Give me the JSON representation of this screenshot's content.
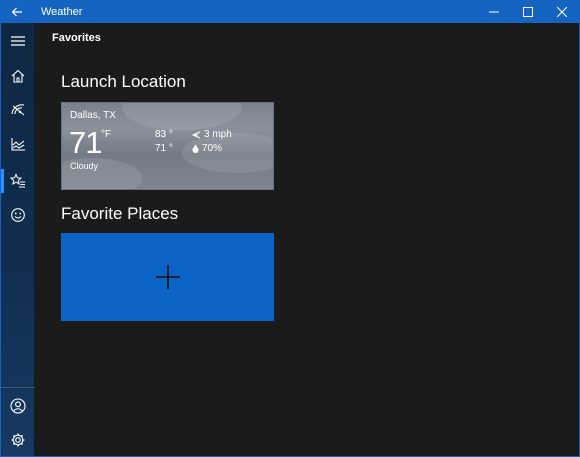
{
  "app": {
    "title": "Weather"
  },
  "page": {
    "title": "Favorites"
  },
  "launch": {
    "heading": "Launch Location",
    "city": "Dallas, TX",
    "temp": "71",
    "unit": "°F",
    "condition": "Cloudy",
    "high": "83 °",
    "low": "71 °",
    "wind": "3 mph",
    "humidity": "70%"
  },
  "favorites": {
    "heading": "Favorite Places"
  },
  "sidebar": {
    "items": [
      {
        "icon": "hamburger-menu-icon"
      },
      {
        "icon": "home-icon"
      },
      {
        "icon": "radar-icon"
      },
      {
        "icon": "historical-chart-icon"
      },
      {
        "icon": "favorites-star-list-icon",
        "active": true
      },
      {
        "icon": "smiley-icon"
      },
      {
        "icon": "account-icon"
      },
      {
        "icon": "settings-gear-icon"
      }
    ]
  },
  "colors": {
    "titlebar": "#1565c0",
    "accent": "#0b63c5",
    "background": "#1b1b1b"
  }
}
